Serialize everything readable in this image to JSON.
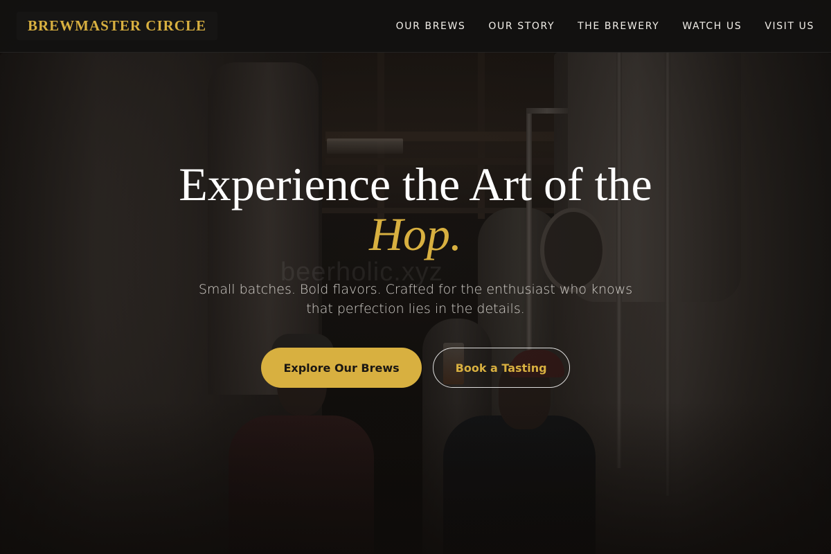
{
  "brand": {
    "name": "BREWMASTER CIRCLE"
  },
  "nav": {
    "items": [
      {
        "label": "OUR BREWS"
      },
      {
        "label": "OUR STORY"
      },
      {
        "label": "THE BREWERY"
      },
      {
        "label": "WATCH US"
      },
      {
        "label": "VISIT US"
      }
    ]
  },
  "hero": {
    "headline": "Experience the Art of the",
    "headline_accent": "Hop.",
    "subtitle": "Small batches. Bold flavors. Crafted for the enthusiast who knows that perfection lies in the details.",
    "primary_cta": "Explore Our Brews",
    "secondary_cta": "Book a Tasting",
    "background_watermark": "beerholic.xyz"
  },
  "colors": {
    "accent": "#d8b040",
    "header_bg": "#121110",
    "text": "#ffffff"
  }
}
